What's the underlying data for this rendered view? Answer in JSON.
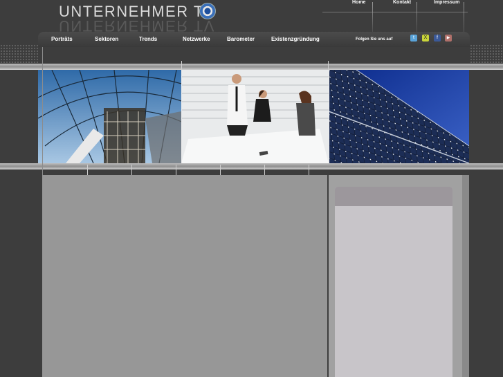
{
  "logo": {
    "text": "UNTERNEHMER TV",
    "reel_icon": "film-reel-icon"
  },
  "top_nav": [
    {
      "label": "Home"
    },
    {
      "label": "Kontakt"
    },
    {
      "label": "Impressum"
    }
  ],
  "main_nav": [
    {
      "label": "Porträts"
    },
    {
      "label": "Sektoren"
    },
    {
      "label": "Trends"
    },
    {
      "label": "Netzwerke"
    },
    {
      "label": "Barometer"
    },
    {
      "label": "Existenzgründung"
    }
  ],
  "follow": {
    "label": "Folgen Sie uns auf",
    "icons": [
      {
        "name": "twitter-icon",
        "glyph": "t",
        "color": "#5aa3d8"
      },
      {
        "name": "xing-icon",
        "glyph": "X",
        "color": "#c9d43a"
      },
      {
        "name": "facebook-icon",
        "glyph": "f",
        "color": "#3b5998"
      },
      {
        "name": "youtube-icon",
        "glyph": "▶",
        "color": "#b0706a"
      }
    ]
  },
  "colors": {
    "background": "#3d3d3d",
    "content_gray": "#979797",
    "sidebar_box": "#c8c5c9",
    "sidebar_header": "#9c979c"
  },
  "banner_images": [
    {
      "name": "glass-dome-architecture-image"
    },
    {
      "name": "business-team-meeting-image"
    },
    {
      "name": "solar-panels-image"
    }
  ]
}
